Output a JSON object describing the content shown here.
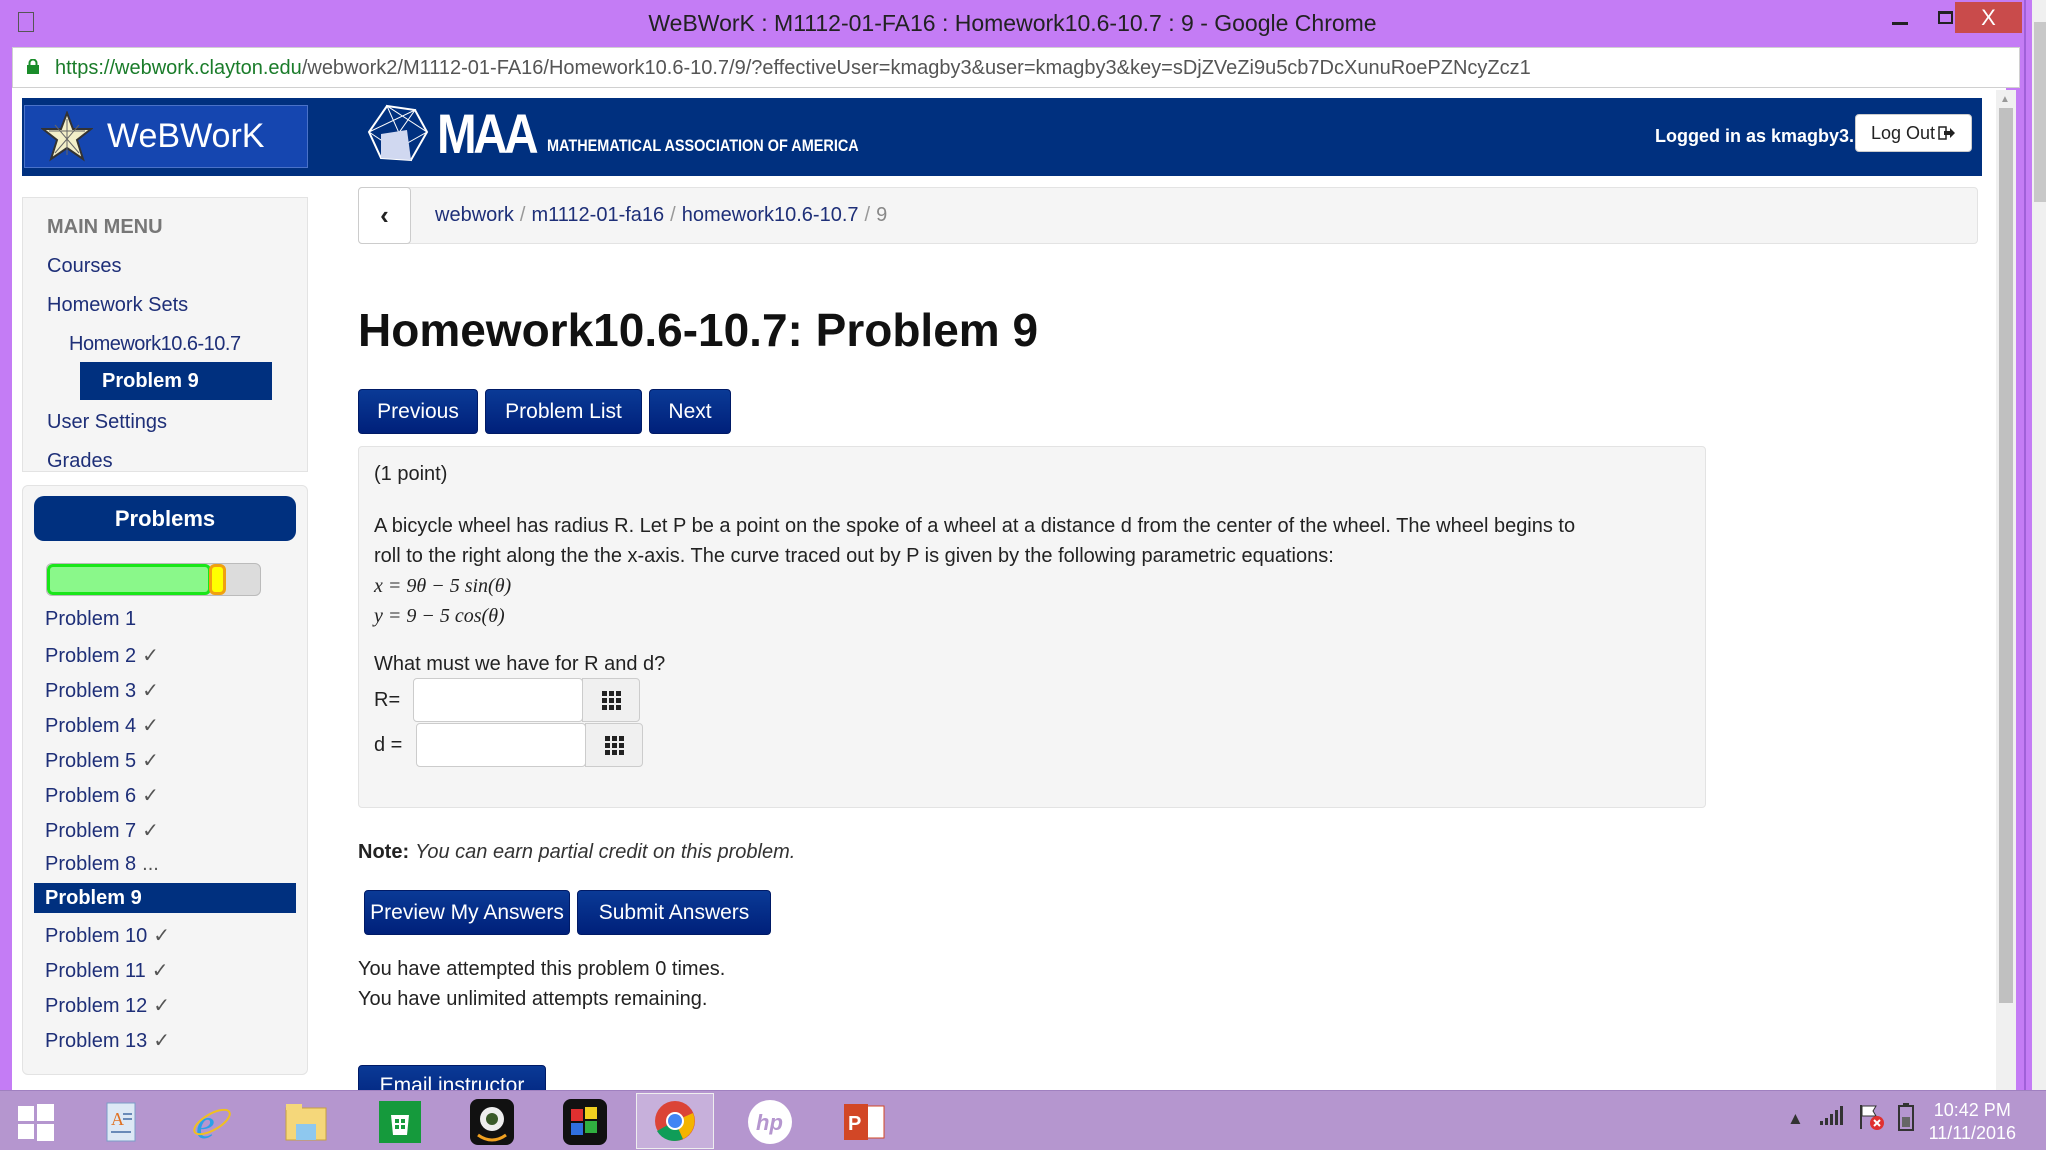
{
  "browser": {
    "window_title": "WeBWorK : M1112-01-FA16 : Homework10.6-10.7 : 9 - Google Chrome",
    "url_scheme": "https://",
    "url_host": "webwork.clayton.edu",
    "url_path": "/webwork2/M1112-01-FA16/Homework10.6-10.7/9/?effectiveUser=kmagby3&user=kmagby3&key=sDjZVeZi9u5cb7DcXunuRoePZNcyZcz1",
    "close_label": "X"
  },
  "header": {
    "logo_text": "WeBWorK",
    "maa_big": "MAA",
    "maa_small": "MATHEMATICAL ASSOCIATION OF AMERICA",
    "logged_in": "Logged in as kmagby3.",
    "logout_label": "Log Out"
  },
  "main_menu": {
    "heading": "MAIN MENU",
    "courses": "Courses",
    "homework_sets": "Homework Sets",
    "set_name": "Homework10.6-10.7",
    "active_problem": "Problem 9",
    "user_settings": "User Settings",
    "grades": "Grades"
  },
  "problems_panel": {
    "heading": "Problems",
    "progress": {
      "correct_fraction": 0.77,
      "partial_fraction": 0.08,
      "color_correct": "#8af88a",
      "color_partial": "#ffff00"
    },
    "items": [
      {
        "label": "Problem 1",
        "status": ""
      },
      {
        "label": "Problem 2",
        "status": "✓"
      },
      {
        "label": "Problem 3",
        "status": "✓"
      },
      {
        "label": "Problem 4",
        "status": "✓"
      },
      {
        "label": "Problem 5",
        "status": "✓"
      },
      {
        "label": "Problem 6",
        "status": "✓"
      },
      {
        "label": "Problem 7",
        "status": "✓"
      },
      {
        "label": "Problem 8",
        "status": "..."
      },
      {
        "label": "Problem 9",
        "status": "",
        "active": true
      },
      {
        "label": "Problem 10",
        "status": "✓"
      },
      {
        "label": "Problem 11",
        "status": "✓"
      },
      {
        "label": "Problem 12",
        "status": "✓"
      },
      {
        "label": "Problem 13",
        "status": "✓"
      }
    ]
  },
  "breadcrumb": {
    "items": [
      "webwork",
      "m1112-01-fa16",
      "homework10.6-10.7"
    ],
    "current": "9",
    "sep": "/"
  },
  "page_title": "Homework10.6-10.7: Problem 9",
  "nav": {
    "previous": "Previous",
    "problem_list": "Problem List",
    "next": "Next"
  },
  "problem": {
    "points": "(1 point)",
    "text_line1": "A bicycle wheel has radius R. Let P be a point on the spoke of a wheel at a distance d from the center of the wheel. The wheel begins to",
    "text_line2": "roll to the right along the the x-axis. The curve traced out by P is given by the following parametric equations:",
    "eq_x": "x = 9θ − 5 sin(θ)",
    "eq_y": "y = 9 − 5 cos(θ)",
    "question": "What must we have for R and d?",
    "r_label": "R=",
    "r_value": "",
    "d_label": "d =",
    "d_value": ""
  },
  "note": {
    "bold": "Note:",
    "text": "You can earn partial credit on this problem."
  },
  "actions": {
    "preview": "Preview My Answers",
    "submit": "Submit Answers",
    "email": "Email instructor"
  },
  "attempts": {
    "line1": "You have attempted this problem 0 times.",
    "line2": "You have unlimited attempts remaining."
  },
  "taskbar": {
    "time": "10:42 PM",
    "date": "11/11/2016",
    "apps": [
      "start",
      "wordpad",
      "internet-explorer",
      "file-explorer",
      "store",
      "webcam",
      "puzzle-app",
      "chrome",
      "hp",
      "powerpoint"
    ]
  }
}
